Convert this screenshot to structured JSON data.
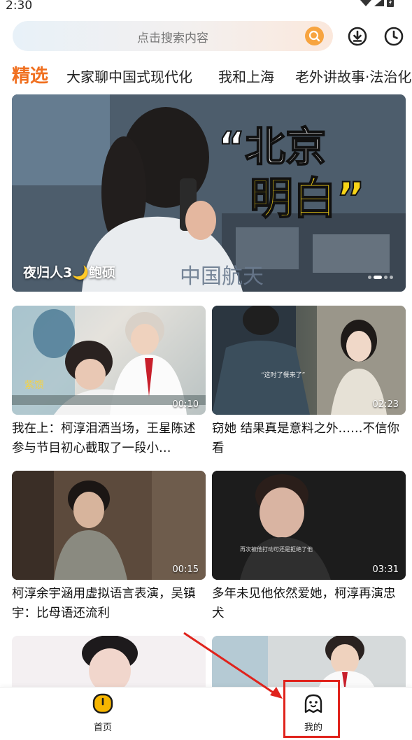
{
  "status_bar": {
    "time": "2:30"
  },
  "search": {
    "placeholder": "点击搜索内容"
  },
  "tabs": [
    {
      "label": "精选",
      "active": true
    },
    {
      "label": "大家聊中国式现代化"
    },
    {
      "label": "我和上海"
    },
    {
      "label": "老外讲故事·法治化"
    }
  ],
  "banner": {
    "caption": "夜归人3🌙鲍硕",
    "overlay_title_line1": "“北京",
    "overlay_title_line2": "明白”",
    "overlay_bottom_text": "中国航天",
    "dots": 4,
    "active_dot": 1
  },
  "videos": [
    {
      "title": "我在上：柯淳泪洒当场，王星陈述参与节目初心截取了一段小…",
      "duration": "00:10",
      "thumb_text": "紫馈"
    },
    {
      "title": "窃她 结果真是意料之外……不信你看",
      "duration": "02:23",
      "thumb_text": "“这时了餐来了”"
    },
    {
      "title": "柯淳余宇涵用虚拟语言表演，吴镇宇：比母语还流利",
      "duration": "00:15"
    },
    {
      "title": "多年未见他依然爱她，柯淳再演忠犬",
      "duration": "03:31",
      "thumb_text": "再次被他打动可还是拒绝了他"
    }
  ],
  "bottom_nav": {
    "home_label": "首页",
    "mine_label": "我的"
  },
  "colors": {
    "accent": "#f07020",
    "search_button": "#f7a440",
    "home_icon": "#f6b500",
    "annotation_red": "#e0231c"
  }
}
